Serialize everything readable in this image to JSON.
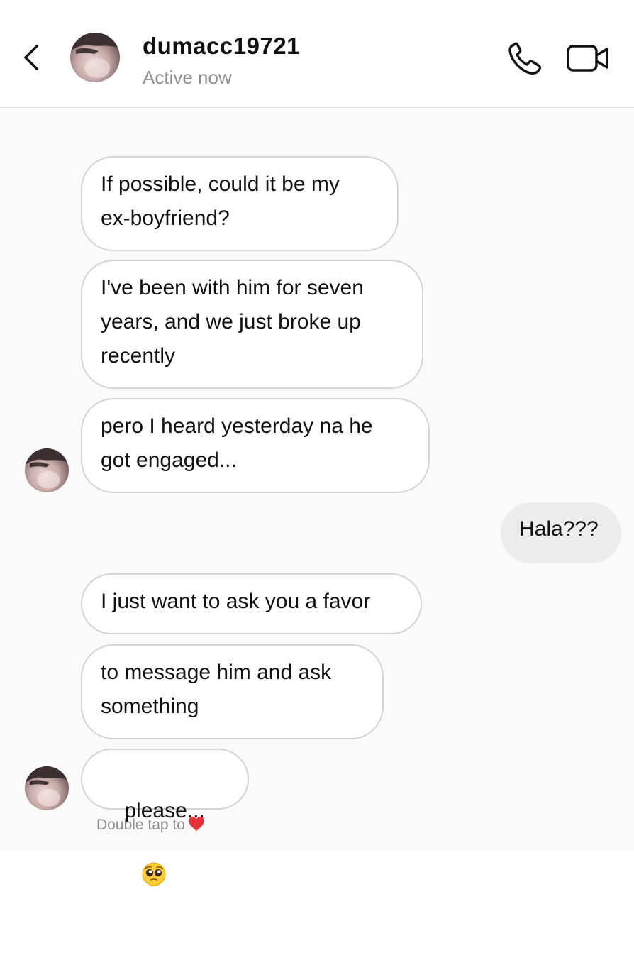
{
  "header": {
    "username": "dumacc19721",
    "status": "Active now",
    "back_icon": "chevron-left-icon",
    "call_icon": "phone-icon",
    "video_icon": "video-camera-icon"
  },
  "messages": [
    {
      "direction": "received",
      "text": "If possible, could it be my\nex-boyfriend?"
    },
    {
      "direction": "received",
      "text": "I've been with him for seven\nyears, and we just broke up\nrecently"
    },
    {
      "direction": "received",
      "text": "pero I heard yesterday na he\ngot engaged...",
      "show_avatar": true
    },
    {
      "direction": "sent",
      "text": "Hala???"
    },
    {
      "direction": "received",
      "text": "I just want to ask you a favor"
    },
    {
      "direction": "received",
      "text": "to message him and ask\nsomething"
    },
    {
      "direction": "received",
      "text": "please...",
      "emoji": "pleading-face-emoji",
      "show_avatar": true
    }
  ],
  "hint": {
    "text": "Double tap to",
    "icon": "red-heart-icon"
  },
  "colors": {
    "received_bubble_border": "#d4d4d4",
    "sent_bubble_bg": "#ececec",
    "secondary_text": "#8e8e8e",
    "heart": "#e8303a"
  }
}
